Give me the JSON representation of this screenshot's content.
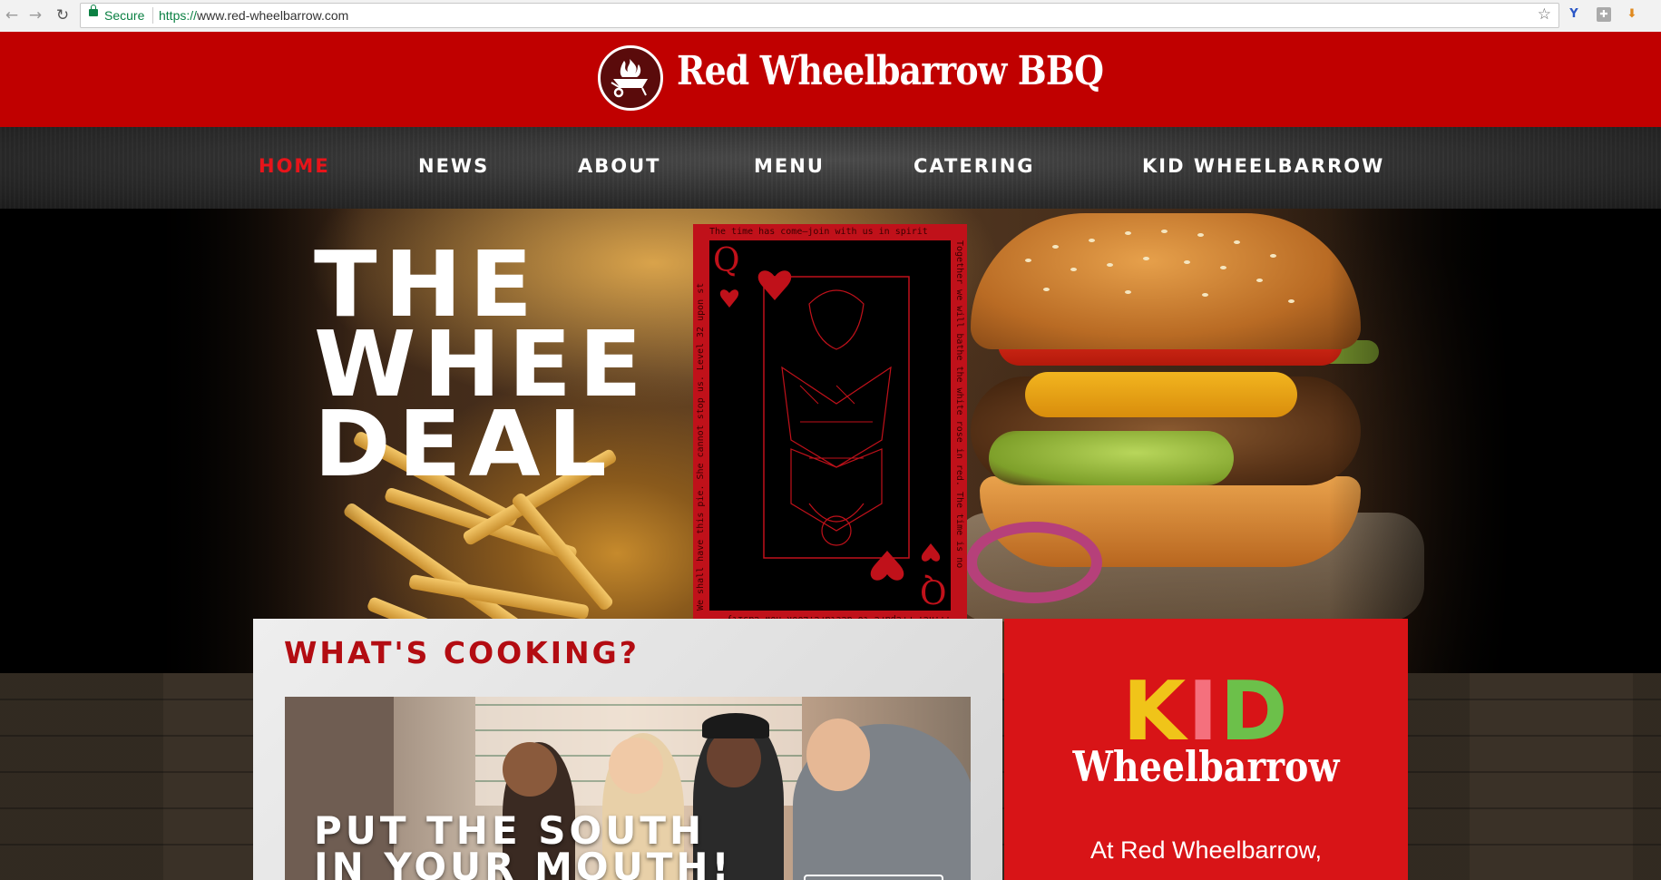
{
  "browser": {
    "secure_label": "Secure",
    "url_scheme": "https://",
    "url_rest": "www.red-wheelbarrow.com"
  },
  "header": {
    "brand": "Red Wheelbarrow BBQ"
  },
  "nav": {
    "items": [
      {
        "label": "HOME",
        "active": true
      },
      {
        "label": "NEWS"
      },
      {
        "label": "ABOUT"
      },
      {
        "label": "MENU"
      },
      {
        "label": "CATERING"
      },
      {
        "label": "KID WHEELBARROW"
      }
    ]
  },
  "hero": {
    "headline_lines": [
      "THE",
      "WHEE",
      "DEAL"
    ],
    "card": {
      "rank": "Q",
      "suit": "hearts",
      "border_top": "The time has come—join with us in spirit",
      "border_right": "Together we will bathe the white rose in red. The time is no",
      "border_bottom": "...ne. Prepare to declare.Look now easily",
      "border_left": "We shall have this pie. She cannot stop us. Level 32 upon st"
    }
  },
  "cooking": {
    "title": "WHAT'S COOKING?",
    "video_line1": "PUT THE SOUTH",
    "video_line2": "IN YOUR MOUTH!"
  },
  "kid_wheelbarrow": {
    "logo_k": "K",
    "logo_i": "I",
    "logo_d": "D",
    "logo_sub": "Wheelbarrow",
    "text": "At Red Wheelbarrow,"
  },
  "colors": {
    "brand_red": "#c00000",
    "active_nav": "#e8141a",
    "title_red": "#b30c12"
  },
  "icons": [
    "back-arrow-icon",
    "forward-arrow-icon",
    "reload-icon",
    "lock-icon",
    "bookmark-star-icon",
    "download-icon",
    "wheelbarrow-flame-logo-icon"
  ]
}
